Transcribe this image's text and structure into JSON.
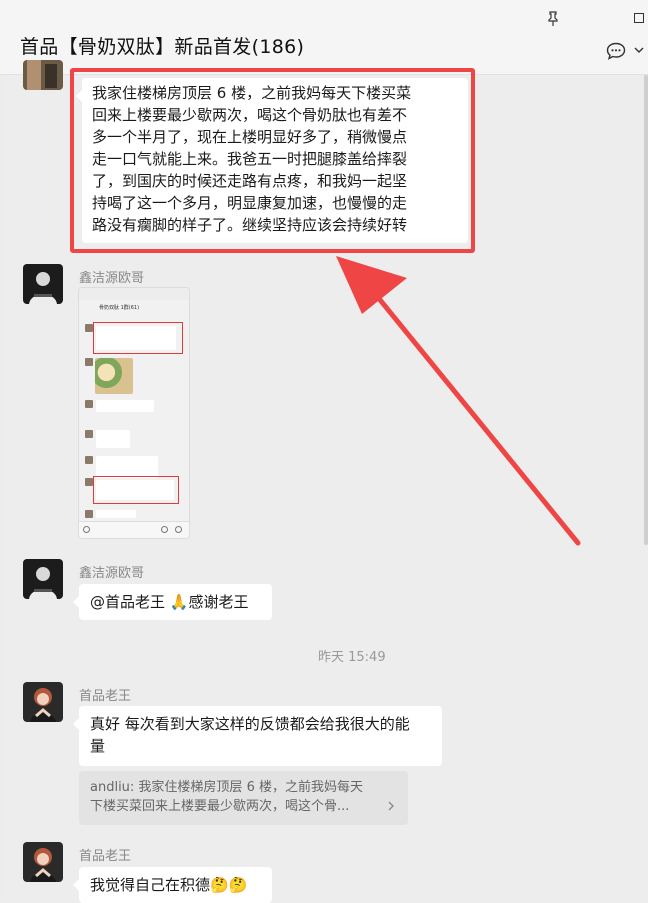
{
  "window": {
    "title": "首品【骨奶双肽】新品首发(186)",
    "pin_icon": "pin-icon",
    "maximize_icon": "maximize-icon",
    "more_icon": "chat-bubble-more-icon",
    "dropdown_icon": "chevron-down-icon"
  },
  "messages": [
    {
      "sender": "",
      "text_lines": [
        "我家住楼梯房顶层 6 楼，之前我妈每天下楼买菜",
        "回来上楼要最少歇两次，喝这个骨奶肽也有差不",
        "多一个半月了，现在上楼明显好多了，稍微慢点",
        "走一口气就能上来。我爸五一时把腿膝盖给摔裂",
        "了，到国庆的时候还走路有点疼，和我妈一起坚",
        "持喝了这一个多月，明显康复加速，也慢慢的走",
        "路没有瘸脚的样子了。继续坚持应该会持续好转"
      ]
    },
    {
      "sender": "鑫洁源欧哥",
      "type": "image",
      "image_title": "骨奶双肽 1群(61)"
    },
    {
      "sender": "鑫洁源欧哥",
      "text": "@首品老王 🙏感谢老王"
    },
    {
      "timestamp": "昨天 15:49"
    },
    {
      "sender": "首品老王",
      "text_lines": [
        "真好 每次看到大家这样的反馈都会给我很大的能",
        "量"
      ],
      "quote_lines": [
        "andliu: 我家住楼梯房顶层 6 楼，之前我妈每天",
        "下楼买菜回来上楼要最少歇两次，喝这个骨..."
      ]
    },
    {
      "sender": "首品老王",
      "text": "我觉得自己在积德🤔🤔"
    }
  ],
  "annotation": {
    "color": "#ef4545"
  },
  "colors": {
    "background": "#ededed",
    "bubble": "#ffffff",
    "quote": "#e3e3e3",
    "accent_red": "#ef4545"
  }
}
